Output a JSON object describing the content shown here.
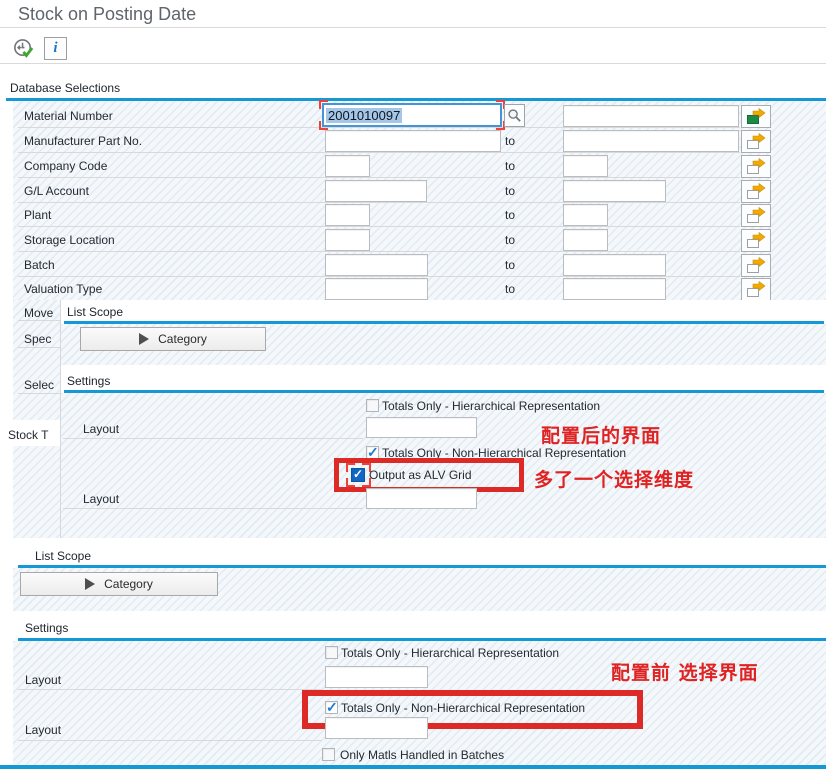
{
  "window": {
    "title": "Stock on Posting Date"
  },
  "toolbar": {
    "execute_icon": "execute",
    "info_icon": "information"
  },
  "database_selections": {
    "header": "Database Selections",
    "to_label": "to",
    "rows": [
      {
        "label": "Material Number",
        "value": "2001010097"
      },
      {
        "label": "Manufacturer Part No."
      },
      {
        "label": "Company Code"
      },
      {
        "label": "G/L Account"
      },
      {
        "label": "Plant"
      },
      {
        "label": "Storage Location"
      },
      {
        "label": "Batch"
      },
      {
        "label": "Valuation Type"
      }
    ]
  },
  "hidden_labels": {
    "movement": "Move",
    "special": "Spec",
    "selection": "Selec",
    "stock_type": "Stock T"
  },
  "overlay_after": {
    "list_scope_header": "List Scope",
    "category_button": "Category",
    "settings_header": "Settings",
    "totals_hierarchical": "Totals Only - Hierarchical Representation",
    "layout_label_1": "Layout",
    "totals_non_hierarchical": "Totals Only - Non-Hierarchical Representation",
    "output_alv": "Output as ALV Grid",
    "layout_label_2": "Layout",
    "annotation_1": "配置后的界面",
    "annotation_2": "多了一个选择维度"
  },
  "section_before": {
    "list_scope_header": "List Scope",
    "category_button": "Category",
    "settings_header": "Settings",
    "totals_hierarchical": "Totals Only - Hierarchical Representation",
    "layout_label_1": "Layout",
    "totals_non_hierarchical": "Totals Only - Non-Hierarchical Representation",
    "layout_label_2": "Layout",
    "only_batches": "Only Matls Handled in Batches",
    "annotation": "配置前 选择界面"
  },
  "colors": {
    "accent_blue": "#1598d6",
    "annotation_red": "#df2322",
    "arrow_orange": "#f2a900",
    "multi_select_green": "#1d8a45",
    "check_blue": "#1b7ad0",
    "title_gray": "#60656a"
  }
}
